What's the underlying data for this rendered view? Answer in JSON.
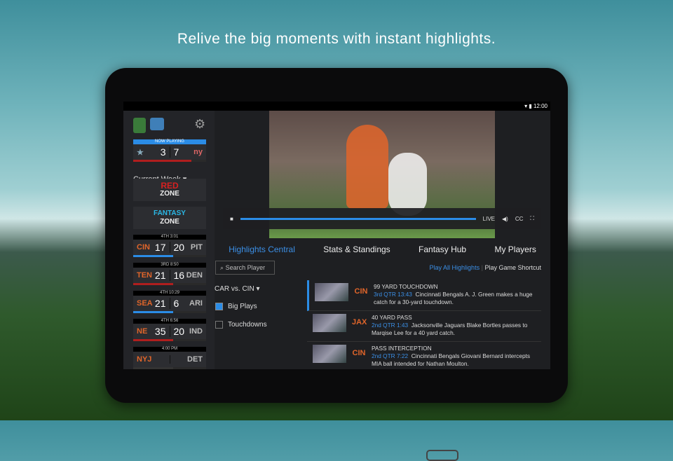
{
  "tagline": "Relive the big moments with instant highlights.",
  "status": {
    "time": "12:00"
  },
  "sidebar": {
    "now_playing": {
      "label": "NOW PLAYING",
      "home": "DAL",
      "home_score": "3",
      "away_score": "7",
      "away": "ny"
    },
    "week_label": "Current Week",
    "red_zone": [
      "RED",
      "ZONE"
    ],
    "fantasy_zone": [
      "FANTASY",
      "ZONE"
    ],
    "games": [
      {
        "status": "4TH 3:01",
        "home": "CIN",
        "home_score": "17",
        "away_score": "20",
        "away": "PIT"
      },
      {
        "status": "3RD 8:50",
        "home": "TEN",
        "home_score": "21",
        "away_score": "16",
        "away": "DEN"
      },
      {
        "status": "4TH 10:29",
        "home": "SEA",
        "home_score": "21",
        "away_score": "6",
        "away": "ARI"
      },
      {
        "status": "4TH 6:56",
        "home": "NE",
        "home_score": "35",
        "away_score": "20",
        "away": "IND"
      },
      {
        "status": "4:00 PM",
        "home": "NYJ",
        "home_score": "",
        "away_score": "",
        "away": "DET"
      }
    ]
  },
  "video": {
    "live": "LIVE",
    "cc": "CC",
    "progress": 1.0
  },
  "tabs": [
    "Highlights Central",
    "Stats & Standings",
    "Fantasy Hub",
    "My Players"
  ],
  "filters": {
    "search_placeholder": "Search Player",
    "game": "CAR vs. CIN",
    "checkboxes": [
      {
        "label": "Big Plays",
        "checked": true
      },
      {
        "label": "Touchdowns",
        "checked": false
      }
    ]
  },
  "links": {
    "play_all": "Play All Highlights",
    "shortcut": "Play Game Shortcut"
  },
  "highlights": [
    {
      "title": "99 YARD TOUCHDOWN",
      "time": "3rd QTR 13:43",
      "desc": "Cincinnati Bengals A. J. Green makes a huge catch for a 30-yard touchdown.",
      "team": "CIN"
    },
    {
      "title": "40 YARD PASS",
      "time": "2nd QTR 1:43",
      "desc": "Jacksonville Jaguars Blake Bortles passes to Marqise Lee for a 40 yard catch.",
      "team": "JAX"
    },
    {
      "title": "PASS INTERCEPTION",
      "time": "2nd QTR 7:22",
      "desc": "Cincinnati Bengals Giovani Bernard intercepts MIA ball intended for Nathan Moulton.",
      "team": "CIN"
    }
  ],
  "colors": {
    "accent": "#2b8ce6",
    "sidebar": "#232428"
  }
}
